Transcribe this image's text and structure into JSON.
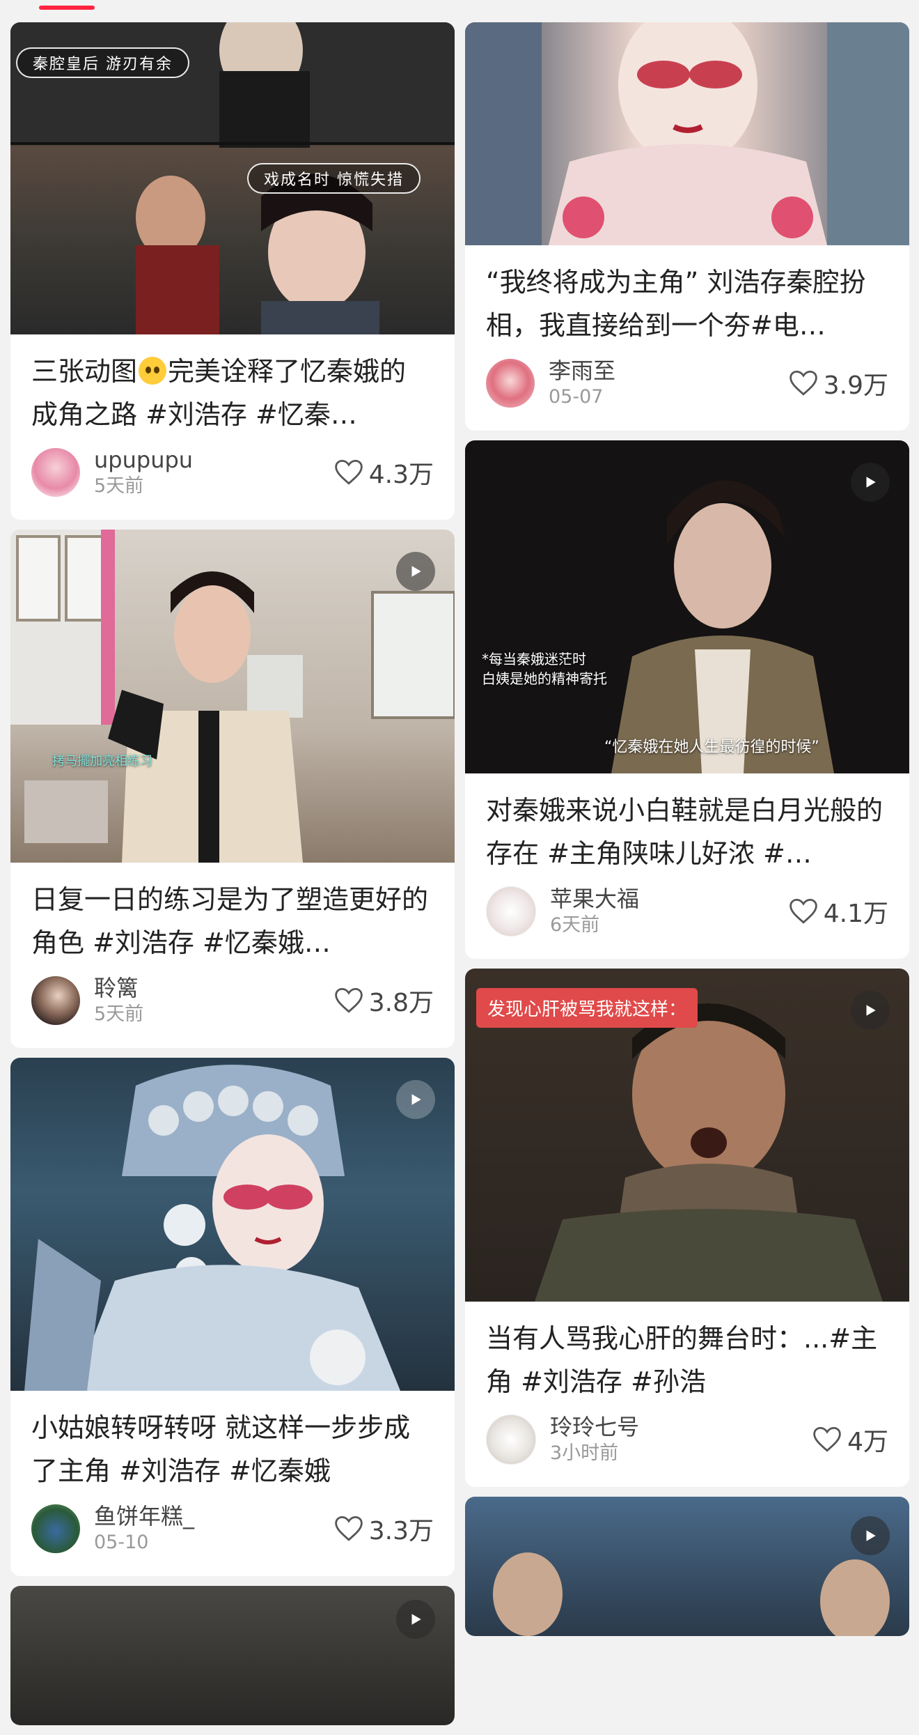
{
  "colors": {
    "accent": "#ff2442",
    "card_bg": "#ffffff",
    "page_bg": "#f2f2f2"
  },
  "cards": [
    {
      "title": "三张动图🥺完美诠释了忆秦娥的成角之路 #刘浩存 #忆秦…",
      "title_before_emoji": "三张动图",
      "title_after_emoji": "完美诠释了忆秦娥的成角之路 #刘浩存  #忆秦…",
      "author": "upupupu",
      "time": "5天前",
      "likes": "4.3万",
      "overlay_top": "秦腔皇后 游刃有余",
      "overlay_mid": "戏成名时 惊慌失措"
    },
    {
      "title": "日复一日的练习是为了塑造更好的角色 #刘浩存  #忆秦娥…",
      "author": "聆篱",
      "time": "5天前",
      "likes": "3.8万",
      "overlay": "拷马擺加亮相练习",
      "has_video": true
    },
    {
      "title": "小姑娘转呀转呀 就这样一步步成了主角 #刘浩存  #忆秦娥",
      "author": "鱼饼年糕_",
      "time": "05-10",
      "likes": "3.3万",
      "has_video": true
    },
    {
      "title": "“我终将成为主角” 刘浩存秦腔扮相，我直接给到一个夯#电…",
      "author": "李雨至",
      "time": "05-07",
      "likes": "3.9万"
    },
    {
      "title": "对秦娥来说小白鞋就是白月光般的存在 #主角陕味儿好浓 #…",
      "author": "苹果大福",
      "time": "6天前",
      "likes": "4.1万",
      "overlay_a": "*每当秦娥迷茫时\n白姨是她的精神寄托",
      "overlay_b": "“忆秦娥在她人生最彷徨的时候”",
      "has_video": true
    },
    {
      "title": "当有人骂我心肝的舞台时：...#主角 #刘浩存 #孙浩",
      "author": "玲玲七号",
      "time": "3小时前",
      "likes": "4万",
      "tag": "发现心肝被骂我就这样：",
      "has_video": true
    }
  ]
}
